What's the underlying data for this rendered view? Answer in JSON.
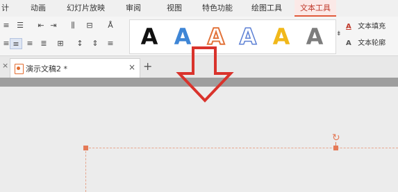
{
  "menu": {
    "items": [
      "计",
      "动画",
      "幻灯片放映",
      "审阅",
      "视图",
      "特色功能",
      "绘图工具",
      "文本工具"
    ]
  },
  "ribbon": {
    "wordart_letter": "A",
    "more_glyph": "⇟",
    "text_fill": "文本填充",
    "text_outline": "文本轮廓"
  },
  "tabs": {
    "close_prev": "×",
    "doc_title": "演示文稿2 *",
    "close": "×",
    "new_tab": "+"
  },
  "colors": {
    "accent": "#e05a3a",
    "arrow": "#d9332c",
    "handle": "#e47a57"
  }
}
